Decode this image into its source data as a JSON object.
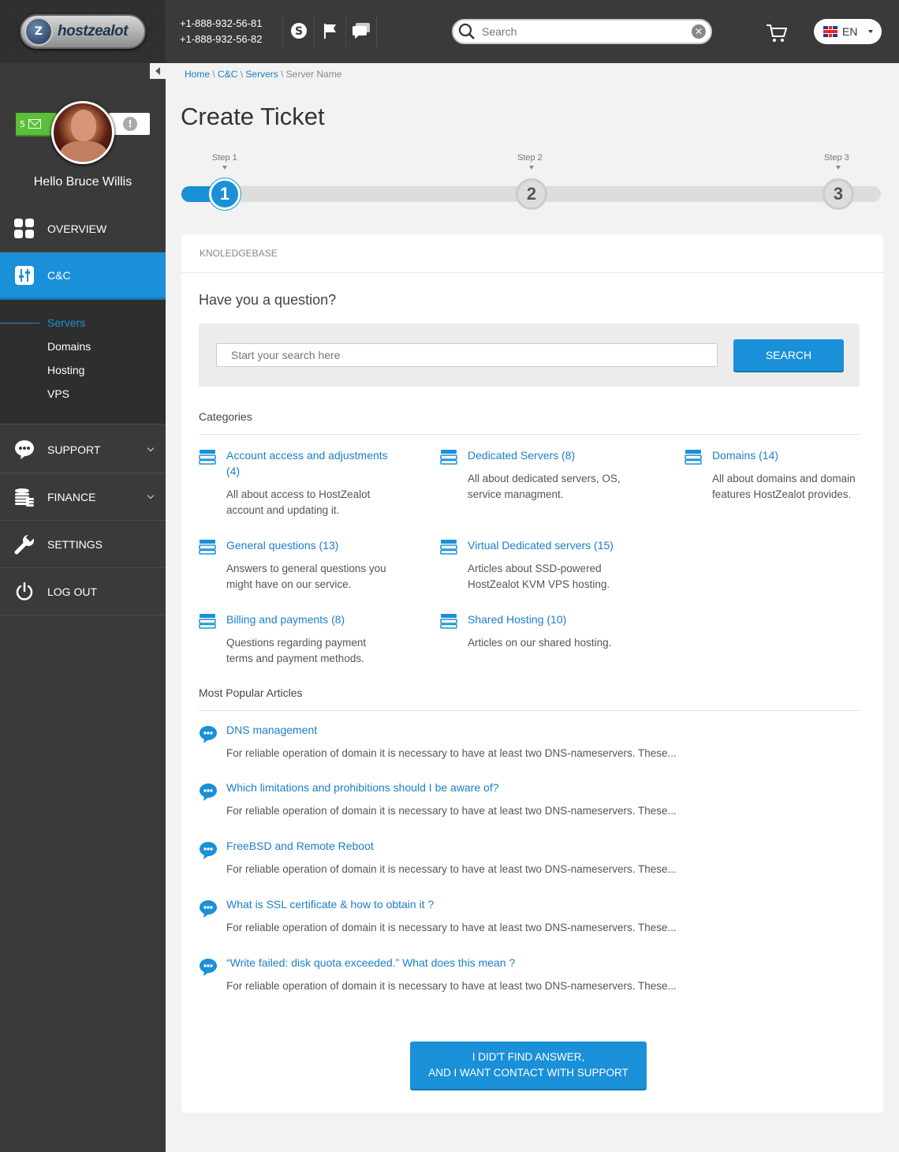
{
  "header": {
    "phones": [
      "+1-888-932-56-81",
      "+1-888-932-56-82"
    ],
    "search_placeholder": "Search",
    "language": "EN"
  },
  "logo": {
    "text": "hostzealot"
  },
  "profile": {
    "mail_count": "5",
    "hello": "Hello",
    "name": "Bruce Willis"
  },
  "nav": {
    "overview": "OVERVIEW",
    "cc": "C&C",
    "submenu": [
      "Servers",
      "Domains",
      "Hosting",
      "VPS"
    ],
    "support": "SUPPORT",
    "finance": "FINANCE",
    "settings": "SETTINGS",
    "logout": "LOG OUT"
  },
  "breadcrumb": {
    "home": "Home",
    "cc": "C&C",
    "servers": "Servers",
    "current": "Server Name",
    "separator": "\\"
  },
  "page_title": "Create Ticket",
  "steps": {
    "labels": [
      "Step 1",
      "Step 2",
      "Step 3"
    ],
    "numbers": [
      "1",
      "2",
      "3"
    ],
    "active": 1
  },
  "card": {
    "header": "KNOLEDGEBASE",
    "question": "Have you a question?",
    "search_placeholder": "Start your search here",
    "search_button": "SEARCH",
    "categories_title": "Categories",
    "categories": [
      {
        "title": "Account access and adjustments (4)",
        "desc": "All about access to HostZealot account and updating it."
      },
      {
        "title": "Dedicated Servers (8)",
        "desc": "All about dedicated servers, OS, service managment."
      },
      {
        "title": "Domains (14)",
        "desc": "All about domains and domain features HostZealot provides."
      },
      {
        "title": "General questions (13)",
        "desc": "Answers to general questions you might have on our service."
      },
      {
        "title": "Virtual Dedicated servers (15)",
        "desc": "Articles about SSD-powered HostZealot KVM VPS hosting."
      },
      {
        "title": "Billing and payments (8)",
        "desc": "Questions regarding payment terms and payment methods."
      },
      {
        "title": "Shared Hosting (10)",
        "desc": "Articles on our shared hosting."
      }
    ],
    "popular_title": "Most Popular Articles",
    "articles": [
      {
        "title": "DNS management",
        "excerpt": "For reliable operation of domain it is necessary to have at least two DNS-nameservers. These..."
      },
      {
        "title": "Which limitations and prohibitions should I be aware of?",
        "excerpt": "For reliable operation of domain it is necessary to have at least two DNS-nameservers. These..."
      },
      {
        "title": "FreeBSD and Remote Reboot",
        "excerpt": "For reliable operation of domain it is necessary to have at least two DNS-nameservers. These..."
      },
      {
        "title": "What is SSL certificate & how to obtain it ?",
        "excerpt": "For reliable operation of domain it is necessary to have at least two DNS-nameservers. These..."
      },
      {
        "title": "“Write failed: disk quota exceeded.” What does this mean ?",
        "excerpt": "For reliable operation of domain it is necessary to have at least two DNS-nameservers. These..."
      }
    ],
    "contact_button": [
      "I DID'T FIND ANSWER,",
      "AND I WANT CONTACT WITH SUPPORT"
    ]
  },
  "colors": {
    "accent": "#1a90d8",
    "sidebar": "#3a3a3a",
    "header": "#3a3a3a"
  }
}
